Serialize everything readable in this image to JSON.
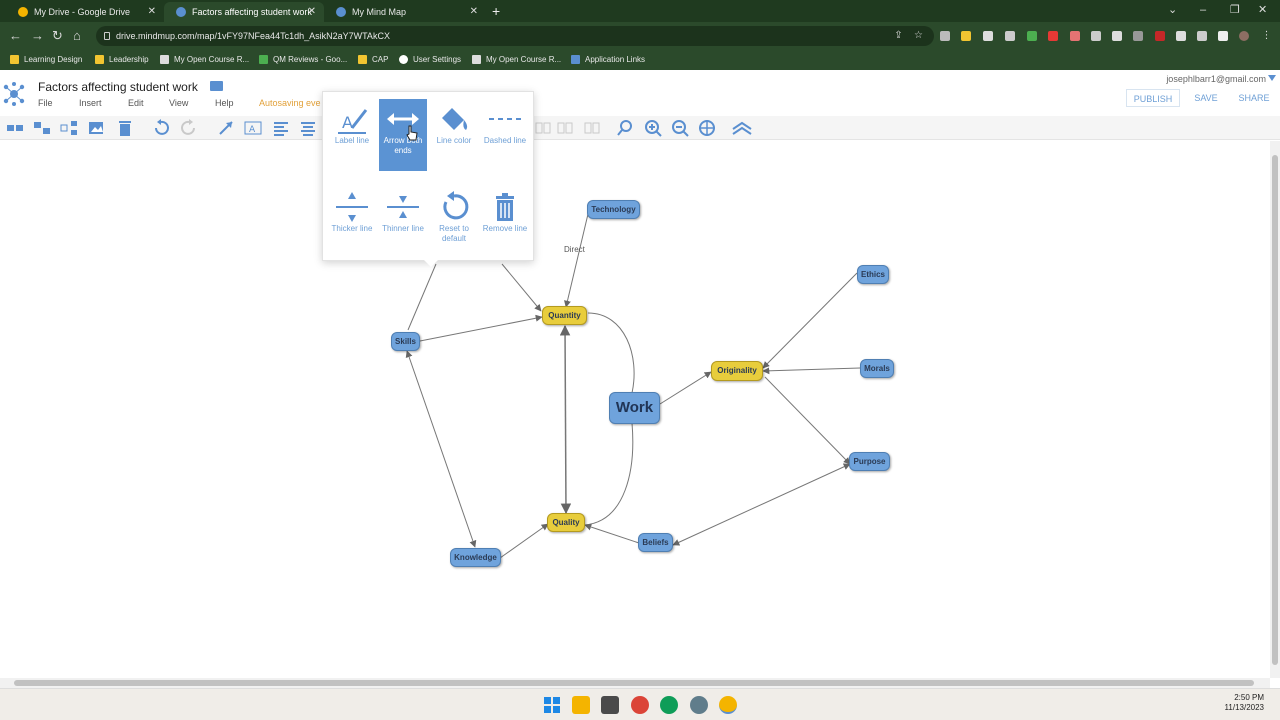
{
  "browser": {
    "tabs": [
      {
        "title": "My Drive - Google Drive",
        "color": "#f4b400"
      },
      {
        "title": "Factors affecting student work",
        "color": "#5a8fd0"
      },
      {
        "title": "My Mind Map",
        "color": "#5a8fd0"
      }
    ],
    "new_tab": "+",
    "url": "drive.mindmup.com/map/1vFY97NFea44Tc1dh_AsikN2aY7WTAkCX",
    "bookmarks": [
      "Learning Design",
      "Leadership",
      "My Open Course R...",
      "QM Reviews - Goo...",
      "CAP",
      "User Settings",
      "My Open Course R...",
      "Application Links"
    ]
  },
  "app": {
    "doc_title": "Factors affecting student work",
    "menu": [
      "File",
      "Insert",
      "Edit",
      "View",
      "Help"
    ],
    "autosave": "Autosaving eve",
    "account": "josephlbarr1@gmail.com",
    "actions": {
      "publish": "PUBLISH",
      "save": "SAVE",
      "share": "SHARE"
    },
    "accent": "#6fa0d6"
  },
  "popup": {
    "label_line": "Label line",
    "arrow_both_ends": "Arrow both ends",
    "line_color": "Line color",
    "dashed_line": "Dashed line",
    "thicker_line": "Thicker line",
    "thinner_line": "Thinner line",
    "reset_default": "Reset to default",
    "remove_line": "Remove line"
  },
  "map": {
    "nodes": {
      "technology": "Technology",
      "ethics": "Ethics",
      "quantity": "Quantity",
      "skills": "Skills",
      "originality": "Originality",
      "morals": "Morals",
      "work": "Work",
      "purpose": "Purpose",
      "quality": "Quality",
      "beliefs": "Beliefs",
      "knowledge": "Knowledge"
    },
    "edge_label_direct": "Direct",
    "colors": {
      "topic": "#6fa3dc",
      "key": "#e8cd3c"
    }
  },
  "taskbar": {
    "time": "2:50 PM",
    "date": "11/13/2023"
  }
}
